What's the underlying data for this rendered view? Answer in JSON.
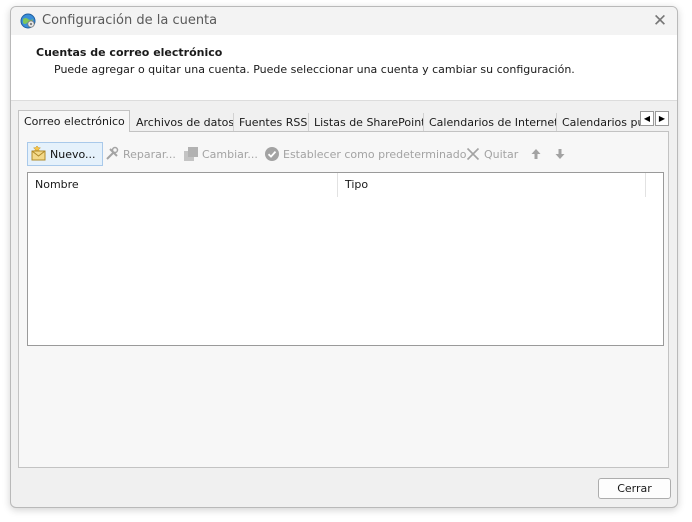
{
  "window": {
    "title": "Configuración de la cuenta",
    "close_glyph": "✕"
  },
  "header": {
    "title": "Cuentas de correo electrónico",
    "description": "Puede agregar o quitar una cuenta. Puede seleccionar una cuenta y cambiar su configuración."
  },
  "tabs": [
    {
      "label": "Correo electrónico",
      "active": true
    },
    {
      "label": "Archivos de datos",
      "active": false
    },
    {
      "label": "Fuentes RSS",
      "active": false
    },
    {
      "label": "Listas de SharePoint",
      "active": false
    },
    {
      "label": "Calendarios de Internet",
      "active": false
    },
    {
      "label": "Calendarios publicados",
      "active": false
    }
  ],
  "tab_scroll": {
    "left": "◀",
    "right": "▶"
  },
  "toolbar": {
    "new_label": "Nuevo...",
    "repair_label": "Reparar...",
    "change_label": "Cambiar...",
    "set_default_label": "Establecer como predeterminado",
    "remove_label": "Quitar"
  },
  "accounts_list": {
    "columns": [
      "Nombre",
      "Tipo"
    ],
    "rows": []
  },
  "footer": {
    "close_label": "Cerrar"
  },
  "colors": {
    "accent_border": "#a9c9ea",
    "accent_fill": "#e5f1fb",
    "disabled_text": "#a3a3a3"
  }
}
